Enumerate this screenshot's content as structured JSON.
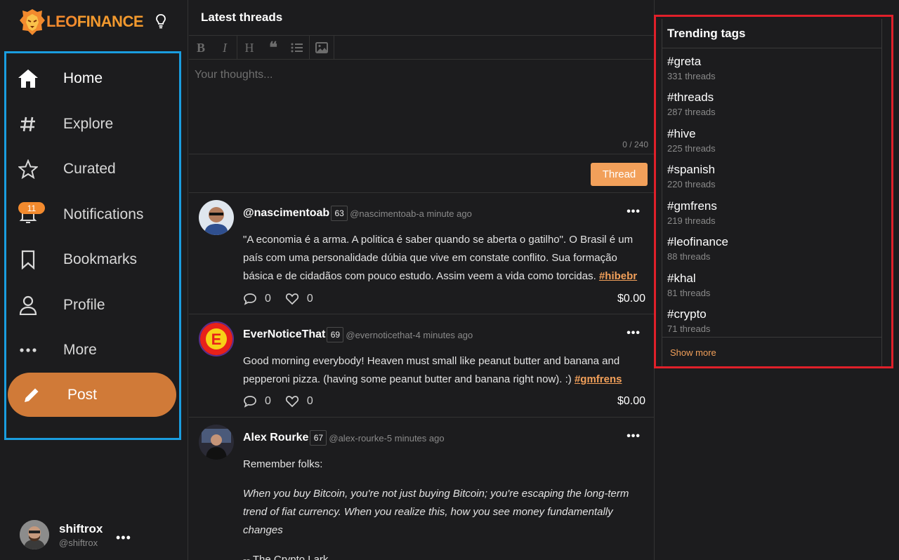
{
  "brand": {
    "name_part1": "LEO",
    "name_part2": "FINANCE",
    "accent": "#f28a2e"
  },
  "sidebar": {
    "items": [
      {
        "label": "Home",
        "icon": "home-icon"
      },
      {
        "label": "Explore",
        "icon": "hashtag-icon"
      },
      {
        "label": "Curated",
        "icon": "star-icon"
      },
      {
        "label": "Notifications",
        "icon": "bell-icon"
      },
      {
        "label": "Bookmarks",
        "icon": "bookmark-icon"
      },
      {
        "label": "Profile",
        "icon": "user-icon"
      },
      {
        "label": "More",
        "icon": "ellipsis-icon"
      }
    ],
    "notifications_badge": "11",
    "post_label": "Post",
    "user": {
      "name": "shiftrox",
      "handle": "@shiftrox",
      "more": "•••"
    }
  },
  "feed": {
    "title": "Latest threads",
    "placeholder": "Your thoughts...",
    "char_count": "0 / 240",
    "thread_button": "Thread",
    "posts": [
      {
        "author": "@nascimentoab",
        "rep": "63",
        "meta": "@nascimentoab-a minute ago",
        "text": "\"A economia é a arma. A politica é saber quando se aberta o gatilho\". O Brasil é um país com uma personalidade dúbia que vive em constate conflito. Sua formação básica e de cidadãos com pouco estudo. Assim veem a vida como torcidas. ",
        "tag": "#hibebr",
        "comments": "0",
        "likes": "0",
        "payout": "$0.00"
      },
      {
        "author": "EverNoticeThat",
        "rep": "69",
        "meta": "@evernoticethat-4 minutes ago",
        "text": "Good morning everybody! Heaven must small like peanut butter and banana and pepperoni pizza. (having some peanut butter and banana right now). :) ",
        "tag": "#gmfrens",
        "comments": "0",
        "likes": "0",
        "payout": "$0.00"
      },
      {
        "author": "Alex Rourke",
        "rep": "67",
        "meta": "@alex-rourke-5 minutes ago",
        "line1": "Remember folks:",
        "quote": "When you buy Bitcoin, you're not just buying Bitcoin; you're escaping the long-term trend of fiat currency. When you realize this, how you see money fundamentally changes",
        "signature": "-- The Crypto Lark"
      }
    ]
  },
  "trending": {
    "title": "Trending tags",
    "tags": [
      {
        "name": "#greta",
        "count": "331 threads"
      },
      {
        "name": "#threads",
        "count": "287 threads"
      },
      {
        "name": "#hive",
        "count": "225 threads"
      },
      {
        "name": "#spanish",
        "count": "220 threads"
      },
      {
        "name": "#gmfrens",
        "count": "219 threads"
      },
      {
        "name": "#leofinance",
        "count": "88 threads"
      },
      {
        "name": "#khal",
        "count": "81 threads"
      },
      {
        "name": "#crypto",
        "count": "71 threads"
      }
    ],
    "show_more": "Show more"
  }
}
